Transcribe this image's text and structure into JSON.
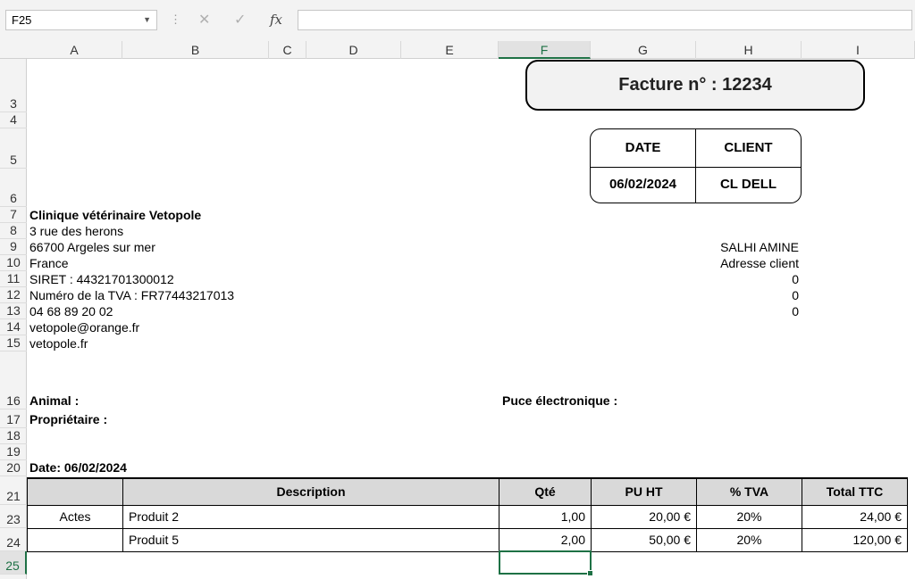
{
  "formula_bar": {
    "cell_ref": "F25",
    "value": "",
    "cancel_icon": "✕",
    "enter_icon": "✓",
    "fx_label": "fx"
  },
  "columns": [
    "A",
    "B",
    "C",
    "D",
    "E",
    "F",
    "G",
    "H",
    "I"
  ],
  "rows": [
    "3",
    "4",
    "5",
    "6",
    "7",
    "8",
    "9",
    "10",
    "11",
    "12",
    "13",
    "14",
    "15",
    "16",
    "17",
    "18",
    "19",
    "20",
    "21",
    "23",
    "24",
    "25"
  ],
  "invoice": {
    "title": "Facture n° : 12234",
    "date_label": "DATE",
    "client_label": "CLIENT",
    "date_value": "06/02/2024",
    "client_value": "CL DELL"
  },
  "company": {
    "name": "Clinique vétérinaire Vetopole",
    "street": "3 rue des herons",
    "city": "66700 Argeles sur mer",
    "country": "France",
    "siret": "SIRET : 44321701300012",
    "tva": "Numéro de la TVA : FR77443217013",
    "phone": "04 68 89 20 02",
    "email": "vetopole@orange.fr",
    "website": "vetopole.fr"
  },
  "client": {
    "name": "SALHI AMINE",
    "address": "Adresse client",
    "line1": "0",
    "line2": "0",
    "line3": "0"
  },
  "fields": {
    "animal": "Animal :",
    "owner": "Propriétaire :",
    "chip": "Puce électronique :",
    "date": "Date: 06/02/2024"
  },
  "table": {
    "headers": [
      "",
      "Description",
      "Qté",
      "PU HT",
      "% TVA",
      "Total TTC"
    ],
    "rows": [
      [
        "Actes",
        "Produit 2",
        "1,00",
        "20,00 €",
        "20%",
        "24,00 €"
      ],
      [
        "",
        "Produit 5",
        "2,00",
        "50,00 €",
        "20%",
        "120,00 €"
      ]
    ]
  }
}
